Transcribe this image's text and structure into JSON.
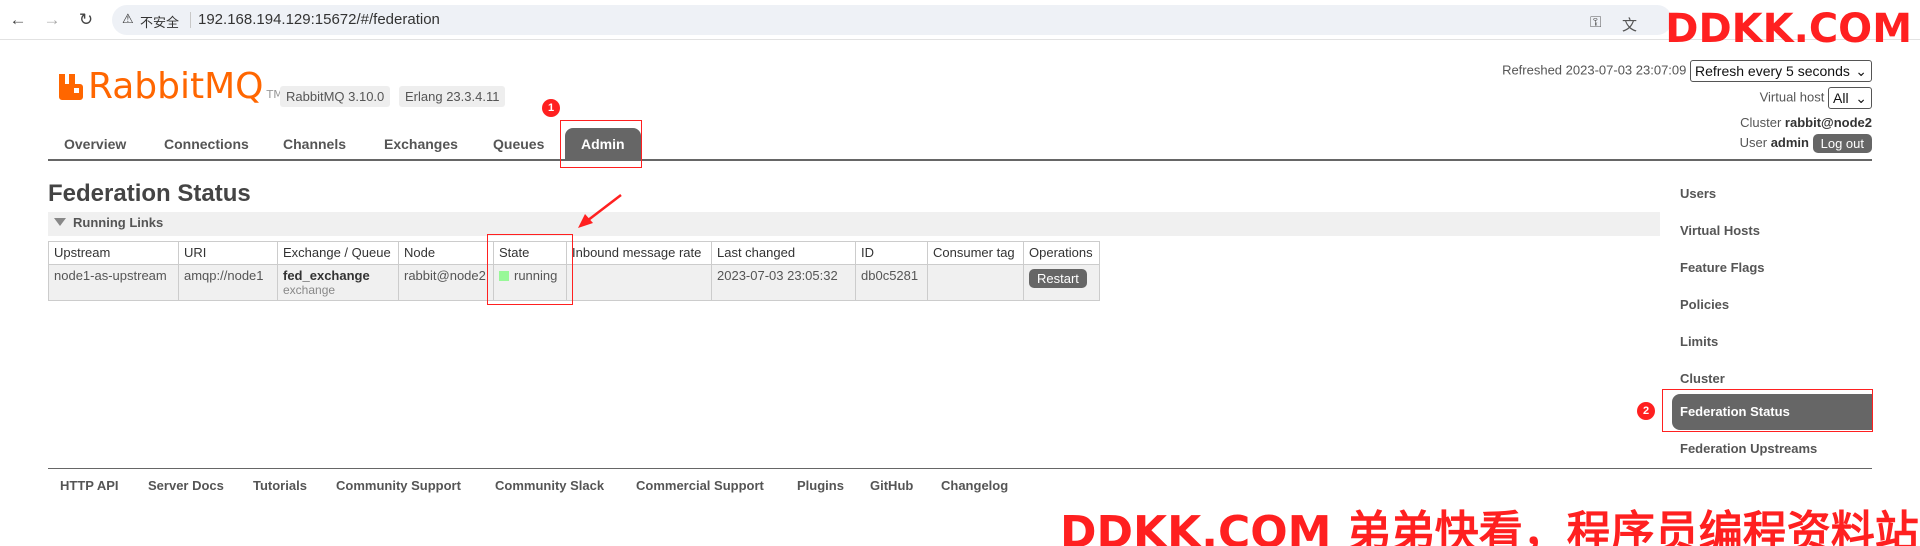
{
  "browser": {
    "insecure_label": "不安全",
    "url": "192.168.194.129:15672/#/federation"
  },
  "watermark": {
    "top": "DDKK.COM",
    "bottom": "DDKK.COM 弟弟快看，程序员编程资料站"
  },
  "app": {
    "logo_text": "RabbitMQ",
    "logo_tm": "TM",
    "rabbitmq_version": "RabbitMQ 3.10.0",
    "erlang_version": "Erlang 23.3.4.11"
  },
  "tabs": [
    {
      "label": "Overview"
    },
    {
      "label": "Connections"
    },
    {
      "label": "Channels"
    },
    {
      "label": "Exchanges"
    },
    {
      "label": "Queues"
    },
    {
      "label": "Admin",
      "active": true
    }
  ],
  "status": {
    "refreshed_label": "Refreshed 2023-07-03 23:07:09",
    "refresh_select": "Refresh every 5 seconds",
    "vhost_label": "Virtual host",
    "vhost_select": "All",
    "cluster_label": "Cluster",
    "cluster_value": "rabbit@node2",
    "user_label": "User",
    "user_value": "admin",
    "logout_label": "Log out"
  },
  "page": {
    "title": "Federation Status",
    "section_label": "Running Links"
  },
  "table": {
    "headers": [
      "Upstream",
      "URI",
      "Exchange / Queue",
      "Node",
      "State",
      "Inbound message rate",
      "Last changed",
      "ID",
      "Consumer tag",
      "Operations"
    ],
    "rows": [
      {
        "upstream": "node1-as-upstream",
        "uri": "amqp://node1",
        "exchange_name": "fed_exchange",
        "exchange_type": "exchange",
        "node": "rabbit@node2",
        "state": "running",
        "inbound_rate": "",
        "last_changed": "2023-07-03 23:05:32",
        "id": "db0c5281",
        "consumer_tag": "",
        "operation_label": "Restart"
      }
    ]
  },
  "admin_menu": [
    {
      "label": "Users"
    },
    {
      "label": "Virtual Hosts"
    },
    {
      "label": "Feature Flags"
    },
    {
      "label": "Policies"
    },
    {
      "label": "Limits"
    },
    {
      "label": "Cluster"
    },
    {
      "label": "Federation Status",
      "selected": true
    },
    {
      "label": "Federation Upstreams"
    }
  ],
  "footer": [
    {
      "label": "HTTP API"
    },
    {
      "label": "Server Docs"
    },
    {
      "label": "Tutorials"
    },
    {
      "label": "Community Support"
    },
    {
      "label": "Community Slack"
    },
    {
      "label": "Commercial Support"
    },
    {
      "label": "Plugins"
    },
    {
      "label": "GitHub"
    },
    {
      "label": "Changelog"
    }
  ],
  "annotations": {
    "marker_1": "1",
    "marker_2": "2"
  },
  "colors": {
    "brand_orange": "#ff6600",
    "annotation_red": "#ff2020",
    "running_green": "#98f898",
    "tab_active": "#666666"
  }
}
